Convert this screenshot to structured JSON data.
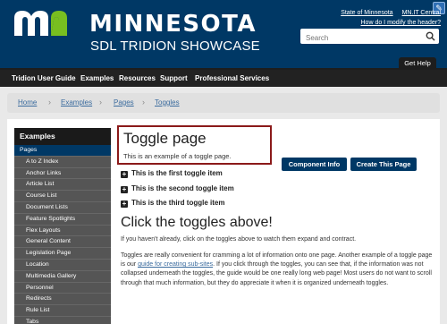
{
  "header": {
    "brand": "MINNESOTA",
    "subtitle": "SDL TRIDION SHOWCASE",
    "links": [
      "State of Minnesota",
      "MN.IT Central",
      "How do I modify the header?"
    ],
    "search_placeholder": "Search",
    "get_help": "Get Help"
  },
  "nav": [
    "Tridion User Guide",
    "Examples",
    "Resources",
    "Support",
    "Professional Services"
  ],
  "breadcrumb": [
    "Home",
    "Examples",
    "Pages",
    "Toggles"
  ],
  "sidebar": {
    "title": "Examples",
    "items": [
      "Pages",
      "A to Z Index",
      "Anchor Links",
      "Article List",
      "Course List",
      "Document Lists",
      "Feature Spotlights",
      "Flex Layouts",
      "General Content",
      "Legislation Page",
      "Location",
      "Multimedia Gallery",
      "Personnel",
      "Redirects",
      "Rule List",
      "Tabs"
    ]
  },
  "main": {
    "title": "Toggle page",
    "intro": "This is an example of a toggle page.",
    "buttons": [
      "Component Info",
      "Create This Page"
    ],
    "toggles": [
      "This is the first toggle item",
      "This is the second toggle item",
      "This is the third toggle item"
    ],
    "heading2": "Click the toggles above!",
    "para1": "If you haven't already, click on the toggles above to watch them expand and contract.",
    "para2_a": "Toggles are really convenient for cramming a lot of information onto one page. Another example of a toggle page is our ",
    "para2_link": "guide for creating sub-sites",
    "para2_b": ". If you click through the toggles, you can see that, if the information was not collapsed underneath the toggles, the guide would be one really long web page! Most users do not want to scroll through that much information, but they do appreciate it when it is organized underneath toggles."
  },
  "icons": {
    "edit": "pencil-icon",
    "search": "search-icon",
    "toggle": "plus-icon"
  },
  "colors": {
    "header_bg": "#003865",
    "logo_green": "#78be20",
    "highlight_border": "#8b1a1a",
    "button_bg": "#003865"
  }
}
